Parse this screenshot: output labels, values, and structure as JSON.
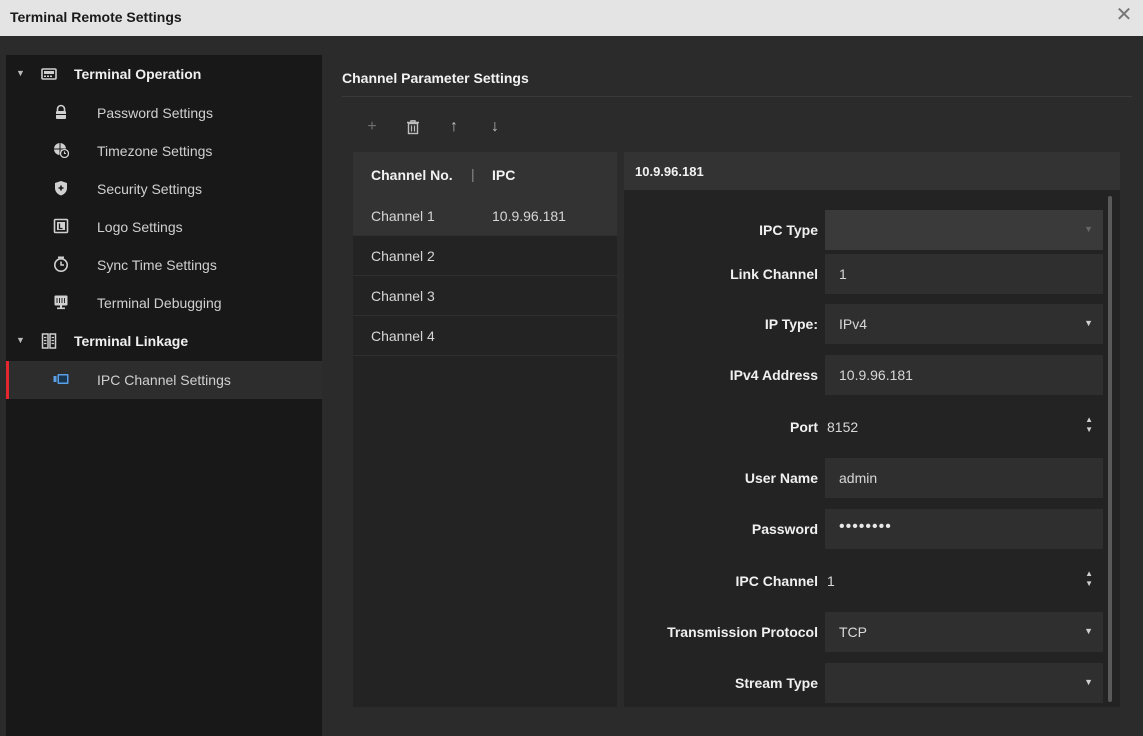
{
  "window": {
    "title": "Terminal Remote Settings",
    "close_glyph": "✕"
  },
  "sidebar": {
    "groups": [
      {
        "label": "Terminal Operation",
        "icon": "terminal-icon",
        "items": [
          {
            "label": "Password Settings",
            "icon": "lock-icon"
          },
          {
            "label": "Timezone Settings",
            "icon": "globe-clock-icon"
          },
          {
            "label": "Security Settings",
            "icon": "shield-icon"
          },
          {
            "label": "Logo Settings",
            "icon": "logo-icon"
          },
          {
            "label": "Sync Time Settings",
            "icon": "sync-clock-icon"
          },
          {
            "label": "Terminal Debugging",
            "icon": "debug-monitor-icon"
          }
        ]
      },
      {
        "label": "Terminal Linkage",
        "icon": "linkage-icon",
        "items": [
          {
            "label": "IPC Channel Settings",
            "icon": "ipc-camera-icon",
            "active": true
          }
        ]
      }
    ]
  },
  "main": {
    "section_title": "Channel Parameter Settings",
    "toolbar": {
      "add": "+",
      "delete": "🗑",
      "move_up": "↑",
      "move_down": "↓"
    },
    "channel_table": {
      "headers": [
        "Channel No.",
        "IPC"
      ],
      "header_separator": "|",
      "rows": [
        {
          "channel": "Channel 1",
          "ipc": "10.9.96.181",
          "selected": true
        },
        {
          "channel": "Channel 2",
          "ipc": ""
        },
        {
          "channel": "Channel 3",
          "ipc": ""
        },
        {
          "channel": "Channel 4",
          "ipc": ""
        }
      ]
    },
    "detail": {
      "header": "10.9.96.181",
      "fields": {
        "ipc_type": {
          "label": "IPC Type",
          "value": ""
        },
        "link_channel": {
          "label": "Link Channel",
          "value": "1"
        },
        "ip_type": {
          "label": "IP Type:",
          "value": "IPv4"
        },
        "ipv4_address": {
          "label": "IPv4 Address",
          "value": "10.9.96.181"
        },
        "port": {
          "label": "Port",
          "value": "8152"
        },
        "user_name": {
          "label": "User Name",
          "value": "admin"
        },
        "password": {
          "label": "Password",
          "value": "••••••••"
        },
        "ipc_channel": {
          "label": "IPC Channel",
          "value": "1"
        },
        "transmission_protocol": {
          "label": "Transmission Protocol",
          "value": "TCP"
        },
        "stream_type": {
          "label": "Stream Type",
          "value": ""
        }
      }
    }
  },
  "colors": {
    "accent_red": "#e2272e",
    "background": "#2b2b2b",
    "sidebar_bg": "#181818",
    "panel_bg": "#232323",
    "field_bg": "#2f2f2f"
  }
}
